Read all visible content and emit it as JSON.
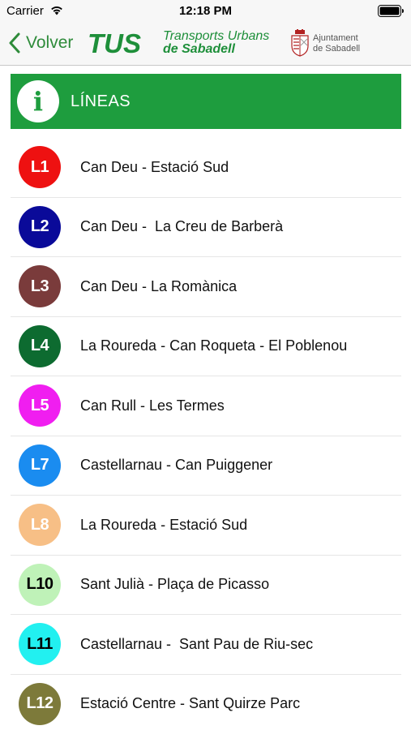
{
  "status_bar": {
    "carrier": "Carrier",
    "time": "12:18 PM"
  },
  "nav": {
    "back_label": "Volver",
    "brand_logo": "TUS",
    "brand_line1": "Transports Urbans",
    "brand_line2": "de Sabadell",
    "council_line1": "Ajuntament",
    "council_line2": "de Sabadell",
    "accent_color": "#2e8b3a"
  },
  "header": {
    "icon": "info-icon",
    "title": "LÍNEAS",
    "color": "#1e9d3e"
  },
  "lines": [
    {
      "code": "L1",
      "name": "Can Deu - Estació Sud",
      "color": "#ee1111",
      "text_color": "#ffffff"
    },
    {
      "code": "L2",
      "name": "Can Deu -  La Creu de Barberà",
      "color": "#0a0a99",
      "text_color": "#ffffff"
    },
    {
      "code": "L3",
      "name": "Can Deu - La Romànica",
      "color": "#7a3b3b",
      "text_color": "#ffffff"
    },
    {
      "code": "L4",
      "name": "La Roureda - Can Roqueta - El Poblenou",
      "color": "#0d6b30",
      "text_color": "#ffffff"
    },
    {
      "code": "L5",
      "name": "Can Rull - Les Termes",
      "color": "#f01ef0",
      "text_color": "#ffffff"
    },
    {
      "code": "L7",
      "name": "Castellarnau - Can Puiggener",
      "color": "#1a8cf0",
      "text_color": "#ffffff"
    },
    {
      "code": "L8",
      "name": "La Roureda - Estació Sud",
      "color": "#f7bf86",
      "text_color": "#ffffff"
    },
    {
      "code": "L10",
      "name": "Sant Julià - Plaça de Picasso",
      "color": "#bff2b8",
      "text_color": "#000000"
    },
    {
      "code": "L11",
      "name": "Castellarnau -  Sant Pau de Riu-sec",
      "color": "#22f0f0",
      "text_color": "#000000"
    },
    {
      "code": "L12",
      "name": "Estació Centre - Sant Quirze Parc",
      "color": "#7d7a3a",
      "text_color": "#ffffff"
    }
  ]
}
